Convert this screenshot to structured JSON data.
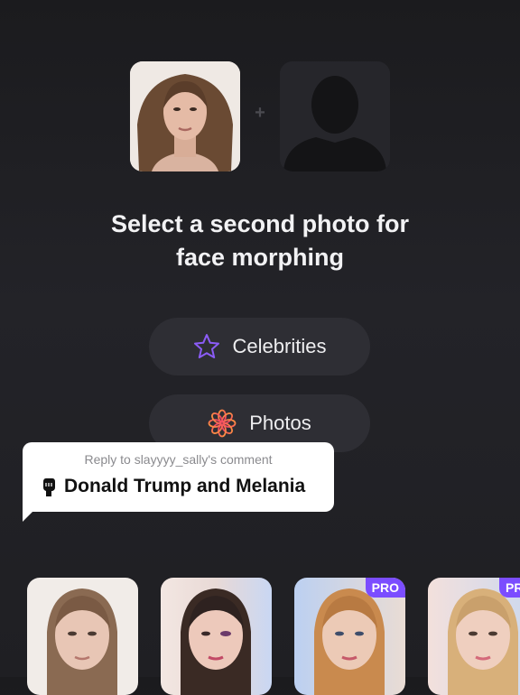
{
  "colors": {
    "background": "#1f1f23",
    "button_bg": "#2e2e34",
    "accent_purple": "#7b4dff",
    "bubble_bg": "#ffffff"
  },
  "morph": {
    "plus": "+",
    "headline_line1": "Select a second photo for",
    "headline_line2": "face morphing"
  },
  "options": {
    "celebrities": {
      "label": "Celebrities",
      "icon": "star-icon"
    },
    "photos": {
      "label": "Photos",
      "icon": "flower-icon"
    }
  },
  "reply": {
    "reply_to": "Reply to slayyyy_sally's comment",
    "text": "Donald Trump and Melania",
    "icon": "fist-icon"
  },
  "filters": [
    {
      "pro": ""
    },
    {
      "pro": ""
    },
    {
      "pro": "PRO"
    },
    {
      "pro": "PRO"
    }
  ]
}
